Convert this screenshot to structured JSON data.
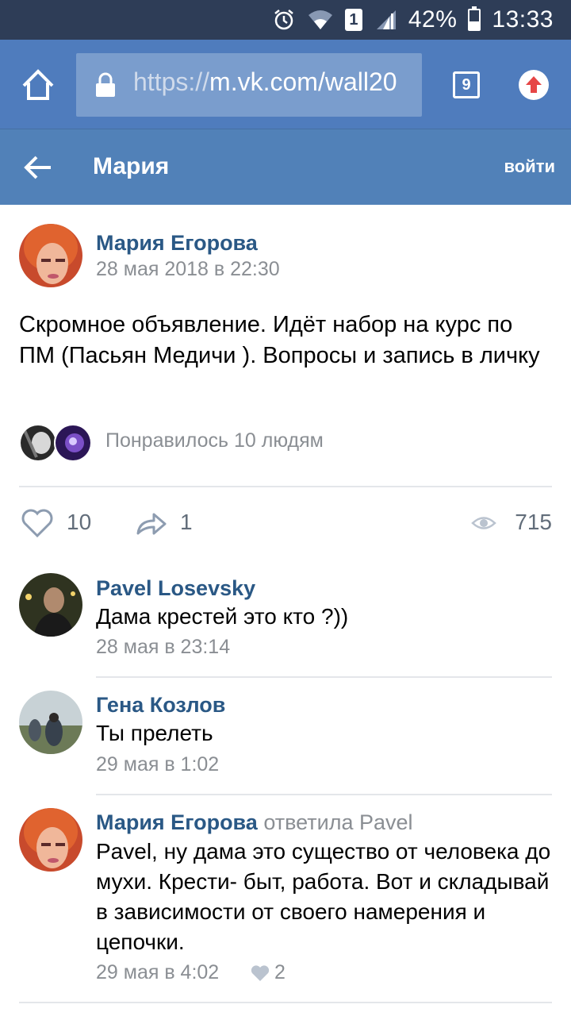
{
  "status_bar": {
    "alarm_icon": "alarm-icon",
    "wifi_icon": "wifi-icon",
    "sim_label": "1",
    "signal_icon": "signal-icon",
    "battery_percent": "42%",
    "battery_level": 0.42,
    "time": "13:33"
  },
  "browser": {
    "url_prefix": "https://",
    "url_host": "m.vk.com/wall20",
    "tabs_count": "9",
    "colors": {
      "bar": "#4f7cbd",
      "url_box": "#7a9dcd",
      "upload": "#e64646"
    }
  },
  "header": {
    "title": "Мария",
    "login_label": "войти",
    "color": "#5181b8"
  },
  "post": {
    "author": "Мария Егорова",
    "date": "28 мая 2018 в 22:30",
    "text": "Скромное объявление. Идёт набор на курс по ПМ (Пасьян Медичи ). Вопросы и запись в личку",
    "likes_text": "Понравилось 10 людям",
    "like_count": "10",
    "share_count": "1",
    "views_count": "715"
  },
  "comments": [
    {
      "author": "Pavel Losevsky",
      "reply_to": "",
      "text": "Дама крестей это кто ?))",
      "date": "28 мая в 23:14",
      "likes": ""
    },
    {
      "author": "Гена Козлов",
      "reply_to": "",
      "text": "Ты прелеть",
      "date": "29 мая в 1:02",
      "likes": ""
    },
    {
      "author": "Мария Егорова",
      "reply_to": "ответила Pavel",
      "text": "Pavel, ну дама это существо от человека до мухи. Крести- быт, работа. Вот и складывай в зависимости от своего намерения и цепочки.",
      "date": "29 мая в 4:02",
      "likes": "2"
    }
  ],
  "theme": {
    "link_color": "#2a5885",
    "meta_color": "#8a8e93",
    "status_bar": "#2e3d57"
  }
}
